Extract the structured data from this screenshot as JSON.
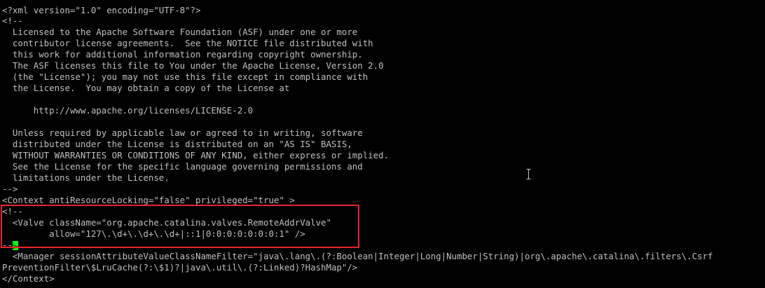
{
  "terminal": {
    "lines": [
      "<?xml version=\"1.0\" encoding=\"UTF-8\"?>",
      "<!--",
      "  Licensed to the Apache Software Foundation (ASF) under one or more",
      "  contributor license agreements.  See the NOTICE file distributed with",
      "  this work for additional information regarding copyright ownership.",
      "  The ASF licenses this file to You under the Apache License, Version 2.0",
      "  (the \"License\"); you may not use this file except in compliance with",
      "  the License.  You may obtain a copy of the License at",
      "",
      "      http://www.apache.org/licenses/LICENSE-2.0",
      "",
      "  Unless required by applicable law or agreed to in writing, software",
      "  distributed under the License is distributed on an \"AS IS\" BASIS,",
      "  WITHOUT WARRANTIES OR CONDITIONS OF ANY KIND, either express or implied.",
      "  See the License for the specific language governing permissions and",
      "  limitations under the License.",
      "-->",
      "<Context antiResourceLocking=\"false\" privileged=\"true\" >",
      "<!--",
      "  <Valve className=\"org.apache.catalina.valves.RemoteAddrValve\"",
      "         allow=\"127\\.\\d+\\.\\d+\\.\\d+|::1|0:0:0:0:0:0:0:1\" />",
      "--",
      "  <Manager sessionAttributeValueClassNameFilter=\"java\\.lang\\.(?:Boolean|Integer|Long|Number|String)|org\\.apache\\.catalina\\.filters\\.Csrf",
      "PreventionFilter\\$LruCache(?:\\$1)?|java\\.util\\.(?:Linked)?HashMap\"/>",
      "</Context>"
    ],
    "cursor_char": ">"
  },
  "colors": {
    "background": "#000000",
    "text": "#c0c0c0",
    "cursor": "#00ff00",
    "highlight": "#e8232a"
  }
}
